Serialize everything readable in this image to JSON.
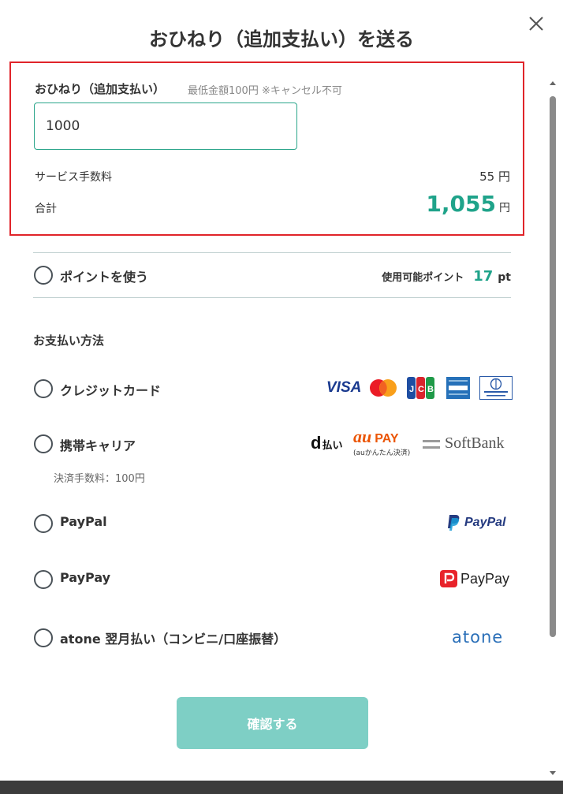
{
  "modal": {
    "title": "おひねり（追加支払い）を送る"
  },
  "amount": {
    "label": "おひねり（追加支払い）",
    "note": "最低金額100円 ※キャンセル不可",
    "input_value": "1000",
    "fee_label": "サービス手数料",
    "fee_value": "55",
    "fee_unit": "円",
    "total_label": "合計",
    "total_value": "1,055",
    "total_unit": "円"
  },
  "points": {
    "label": "ポイントを使う",
    "available_label": "使用可能ポイント",
    "available_value": "17",
    "unit": "pt"
  },
  "payment": {
    "section_title": "お支払い方法",
    "methods": [
      {
        "label": "クレジットカード",
        "logos": [
          "visa-logo",
          "mastercard-logo",
          "jcb-logo",
          "amex-logo",
          "diners-club-logo"
        ]
      },
      {
        "label": "携帯キャリア",
        "sub": "決済手数料：100円",
        "logos": [
          "d-barai-logo",
          "au-pay-logo",
          "softbank-logo"
        ]
      },
      {
        "label": "PayPal",
        "logos": [
          "paypal-logo"
        ]
      },
      {
        "label": "PayPay",
        "logos": [
          "paypay-logo"
        ]
      },
      {
        "label": "atone 翌月払い（コンビニ/口座振替）",
        "logos": [
          "atone-logo"
        ]
      }
    ]
  },
  "logo_text": {
    "visa": "VISA",
    "dbarai_d": "d",
    "dbarai_text": "払い",
    "aupay_au": "au",
    "aupay_pay": "PAY",
    "aupay_sub": "(auかんたん決済)",
    "softbank": "SoftBank",
    "paypal": "PayPal",
    "paypay": "PayPay",
    "atone": "atone"
  },
  "confirm": {
    "label": "確認する"
  },
  "colors": {
    "accent": "#1fa38a",
    "highlight_border": "#e0242a",
    "confirm_bg": "#7ecfc5"
  }
}
